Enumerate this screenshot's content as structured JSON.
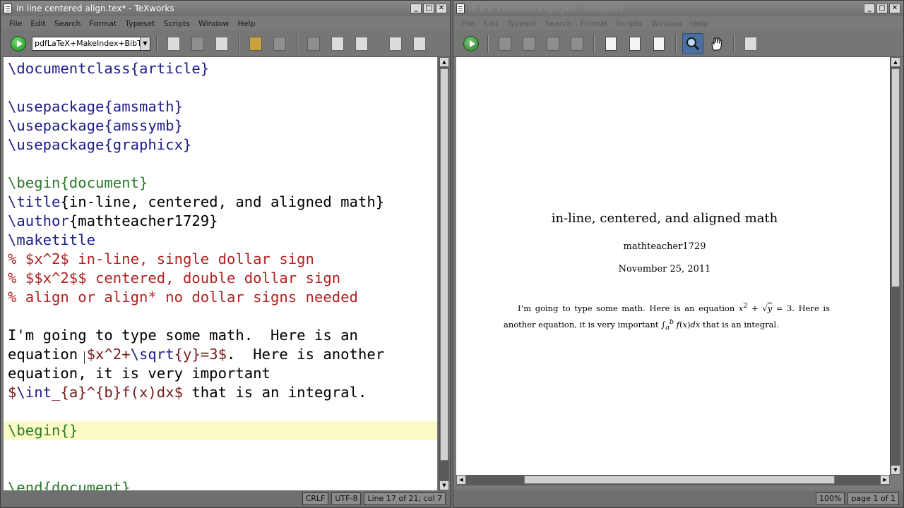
{
  "editor_window": {
    "title": "in line centered align.tex* - TeXworks",
    "menu": [
      "File",
      "Edit",
      "Search",
      "Format",
      "Typeset",
      "Scripts",
      "Window",
      "Help"
    ],
    "typeset_engine": "pdfLaTeX+MakeIndex+BibTeX",
    "lines": [
      [
        {
          "t": "\\documentclass",
          "c": "kw"
        },
        {
          "t": "{article}",
          "c": "arg"
        }
      ],
      [],
      [
        {
          "t": "\\usepackage",
          "c": "kw"
        },
        {
          "t": "{amsmath}",
          "c": "arg"
        }
      ],
      [
        {
          "t": "\\usepackage",
          "c": "kw"
        },
        {
          "t": "{amssymb}",
          "c": "arg"
        }
      ],
      [
        {
          "t": "\\usepackage",
          "c": "kw"
        },
        {
          "t": "{graphicx}",
          "c": "arg"
        }
      ],
      [],
      [
        {
          "t": "\\begin{document}",
          "c": "env"
        }
      ],
      [
        {
          "t": "\\title",
          "c": "kw"
        },
        {
          "t": "{in-line, centered, and aligned math}",
          "c": ""
        }
      ],
      [
        {
          "t": "\\author",
          "c": "kw"
        },
        {
          "t": "{mathteacher1729}",
          "c": ""
        }
      ],
      [
        {
          "t": "\\maketitle",
          "c": "kw"
        }
      ],
      [
        {
          "t": "% $x^2$ in-line, single dollar sign",
          "c": "cmt"
        }
      ],
      [
        {
          "t": "% $$x^2$$ centered, double dollar sign",
          "c": "cmt"
        }
      ],
      [
        {
          "t": "% align or align* no dollar signs needed",
          "c": "cmt"
        }
      ],
      [],
      [
        {
          "t": "I'm going to type some math.  Here is an",
          "c": ""
        }
      ],
      [
        {
          "t": "equation ",
          "c": ""
        },
        {
          "t": "$x^2+",
          "c": "mth"
        },
        {
          "t": "\\sqrt",
          "c": "kw"
        },
        {
          "t": "{y}=3$",
          "c": "mth"
        },
        {
          "t": ".  Here is another",
          "c": ""
        }
      ],
      [
        {
          "t": "equation, it is very important",
          "c": ""
        }
      ],
      [
        {
          "t": "$",
          "c": "mth"
        },
        {
          "t": "\\int",
          "c": "kw"
        },
        {
          "t": "_{a}^{b}f(x)dx$",
          "c": "mth"
        },
        {
          "t": " that is an integral.",
          "c": ""
        }
      ],
      [],
      [
        {
          "t": "\\begin{}",
          "c": "env",
          "hl": true
        }
      ],
      [],
      [],
      [
        {
          "t": "\\end{document}",
          "c": "env"
        }
      ]
    ],
    "status": {
      "line_ending": "CRLF",
      "encoding": "UTF-8",
      "position": "Line 17 of 21; col 7"
    }
  },
  "preview_window": {
    "title": "in line centered align.pdf - TeXworks",
    "menu": [
      "File",
      "Edit",
      "Typeset",
      "Search",
      "Format",
      "Scripts",
      "Window",
      "Help"
    ],
    "document": {
      "title": "in-line, centered, and aligned math",
      "author": "mathteacher1729",
      "date": "November 25, 2011",
      "body_html": "I’m going to type some math.  Here is an equation <i>x</i><sup>2</sup> + √<span style=\"text-decoration:overline\"><i>y</i></span> = 3.  Here is another equation, it is very important ∫<sub><i>a</i></sub><sup><i>b</i></sup> <i>f</i>(<i>x</i>)<i>dx</i> that is an integral."
    },
    "status": {
      "zoom": "100%",
      "page": "page 1 of 1"
    }
  }
}
